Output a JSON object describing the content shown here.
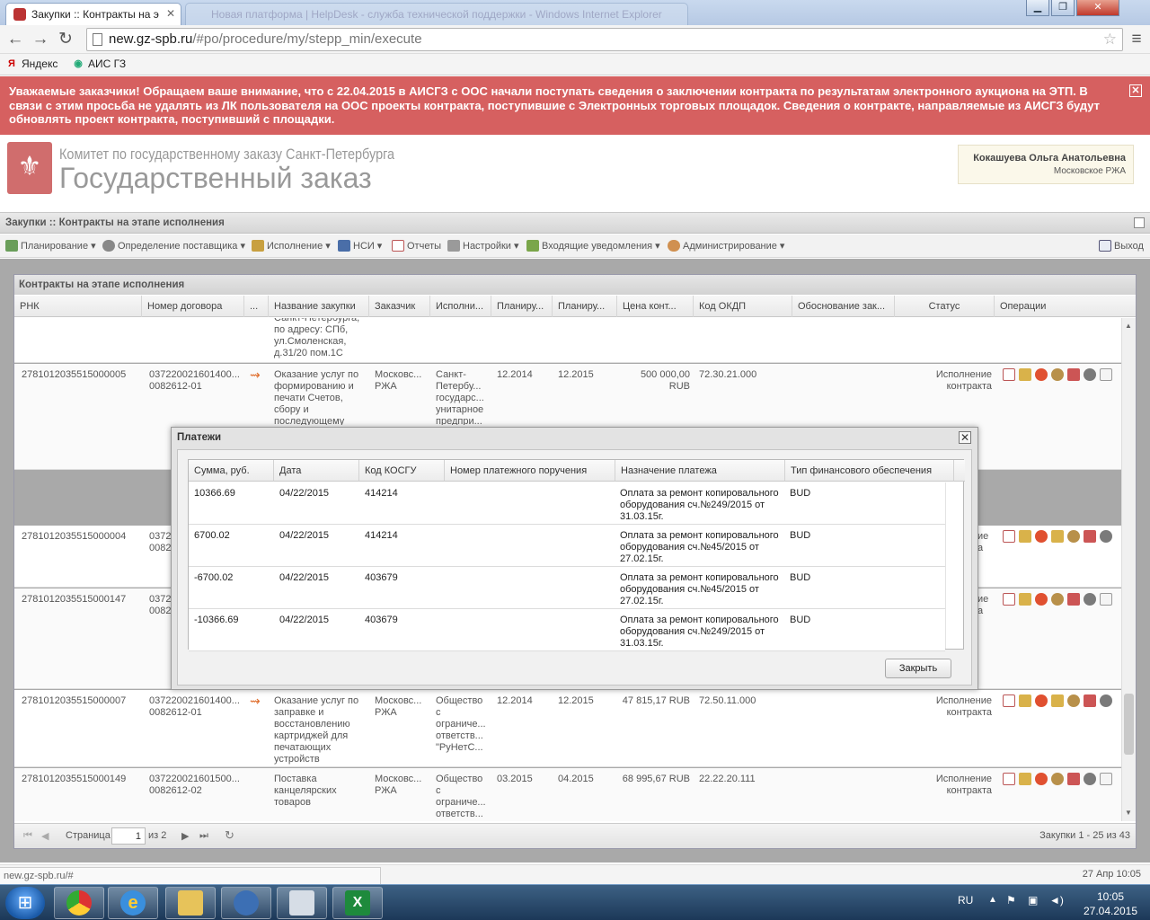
{
  "browser": {
    "active_tab_title": "Закупки :: Контракты на э",
    "background_tab_title": "Новая платформа | HelpDesk - служба технической поддержки - Windows Internet Explorer",
    "url_host": "new.gz-spb.ru",
    "url_path": "/#po/procedure/my/stepp_min/execute",
    "bookmarks": [
      {
        "icon": "yandex-icon",
        "label": "Яндекс"
      },
      {
        "icon": "globe-icon",
        "label": "АИС ГЗ"
      }
    ]
  },
  "notice": {
    "text": "Уважаемые заказчики! Обращаем ваше внимание, что с 22.04.2015 в АИСГЗ с ООС начали поступать сведения о заключении контракта по результатам электронного аукциона на ЭТП. В связи с этим просьба не удалять из ЛК пользователя на ООС проекты контракта, поступившие с Электронных торговых площадок. Сведения о контракте, направляемые из АИСГЗ будут обновлять проект контракта, поступивший с площадки."
  },
  "header": {
    "org_line1": "Комитет по государственному заказу Санкт-Петербурга",
    "org_line2": "Государственный заказ",
    "user_name": "Кокашуева Ольга Анатольевна",
    "user_dept": "Московское РЖА"
  },
  "panel": {
    "title": "Закупки :: Контракты на этапе исполнения"
  },
  "menu": {
    "items": [
      {
        "label": "Планирование",
        "icon": "planning-icon"
      },
      {
        "label": "Определение поставщика",
        "icon": "gears-icon"
      },
      {
        "label": "Исполнение",
        "icon": "execution-icon"
      },
      {
        "label": "НСИ",
        "icon": "book-icon"
      },
      {
        "label": "Отчеты",
        "icon": "report-icon"
      },
      {
        "label": "Настройки",
        "icon": "wrench-icon"
      },
      {
        "label": "Входящие уведомления",
        "icon": "inbox-icon"
      },
      {
        "label": "Администрирование",
        "icon": "user-icon"
      }
    ],
    "exit_label": "Выход"
  },
  "grid": {
    "title": "Контракты на этапе исполнения",
    "columns": [
      "РНК",
      "Номер договора",
      "...",
      "Название закупки",
      "Заказчик",
      "Исполни...",
      "Планиру...",
      "Планиру...",
      "Цена конт...",
      "Код ОКДП",
      "Обоснование зак...",
      "Статус",
      "Операции"
    ],
    "rows": [
      {
        "rnk": "",
        "num": "",
        "name": "Санкт-Петербурга, по адресу: СПб, ул.Смоленская, д.31/20 пом.1С",
        "cust": "",
        "exec": "",
        "p1": "",
        "p2": "",
        "price": "",
        "okdp": "",
        "status": "",
        "ops": 0
      },
      {
        "rnk": "2781012035515000005",
        "num": "037220021601400... 0082612-01",
        "name": "Оказание услуг по формированию и печати Счетов, сбору и последующему",
        "cust": "Московс... РЖА",
        "exec": "Санкт-Петербу... государс... унитарное предпри...",
        "p1": "12.2014",
        "p2": "12.2015",
        "price": "500 000,00 RUB",
        "okdp": "72.30.21.000",
        "status": "Исполнение контракта",
        "ops": 7
      },
      {
        "rnk": "2781012035515000004",
        "num": "03722 0082",
        "name": "",
        "cust": "",
        "exec": "",
        "p1": "",
        "p2": "",
        "price": "",
        "okdp": "",
        "status": "ие а",
        "ops": 7
      },
      {
        "rnk": "2781012035515000147",
        "num": "03722 0082",
        "name": "",
        "cust": "",
        "exec": "",
        "p1": "",
        "p2": "",
        "price": "",
        "okdp": "",
        "status": "ие а",
        "ops": 7
      },
      {
        "rnk": "2781012035515000007",
        "num": "037220021601400... 0082612-01",
        "name": "Оказание услуг по заправке и восстановлению картриджей для печатающих устройств",
        "cust": "Московс... РЖА",
        "exec": "Общество с ограниче... ответств... \"РуНетС...",
        "p1": "12.2014",
        "p2": "12.2015",
        "price": "47 815,17 RUB",
        "okdp": "72.50.11.000",
        "status": "Исполнение контракта",
        "ops": 7
      },
      {
        "rnk": "2781012035515000149",
        "num": "037220021601500... 0082612-02",
        "name": "Поставка канцелярских товаров",
        "cust": "Московс... РЖА",
        "exec": "Общество с ограниче... ответств...",
        "p1": "03.2015",
        "p2": "04.2015",
        "price": "68 995,67 RUB",
        "okdp": "22.22.20.111",
        "status": "Исполнение контракта",
        "ops": 7
      }
    ],
    "pager": {
      "page_label": "Страница",
      "page": "1",
      "of": "из 2",
      "summary": "Закупки 1 - 25 из 43"
    }
  },
  "modal": {
    "title": "Платежи",
    "columns": [
      "Сумма, руб.",
      "Дата",
      "Код КОСГУ",
      "Номер платежного поручения",
      "Назначение платежа",
      "Тип финансового обеспечения"
    ],
    "rows": [
      {
        "sum": "10366.69",
        "date": "04/22/2015",
        "kosgu": "414214",
        "order": "",
        "purpose": "Оплата за ремонт копировального оборудования сч.№249/2015 от 31.03.15г.",
        "type": "BUD"
      },
      {
        "sum": "6700.02",
        "date": "04/22/2015",
        "kosgu": "414214",
        "order": "",
        "purpose": "Оплата за ремонт копировального оборудования сч.№45/2015 от 27.02.15г.",
        "type": "BUD"
      },
      {
        "sum": "-6700.02",
        "date": "04/22/2015",
        "kosgu": "403679",
        "order": "",
        "purpose": "Оплата за ремонт копировального оборудования сч.№45/2015 от 27.02.15г.",
        "type": "BUD"
      },
      {
        "sum": "-10366.69",
        "date": "04/22/2015",
        "kosgu": "403679",
        "order": "",
        "purpose": "Оплата за ремонт копировального оборудования сч.№249/2015 от 31.03.15г.",
        "type": "BUD"
      }
    ],
    "close_label": "Закрыть"
  },
  "statusbar": {
    "url": "new.gz-spb.ru/#",
    "date": "27 Апр 10:05"
  },
  "taskbar": {
    "apps": [
      "chrome-icon",
      "ie-icon",
      "explorer-icon",
      "thunderbird-icon",
      "scanner-icon",
      "excel-icon"
    ],
    "lang": "RU",
    "time": "10:05",
    "date": "27.04.2015"
  }
}
